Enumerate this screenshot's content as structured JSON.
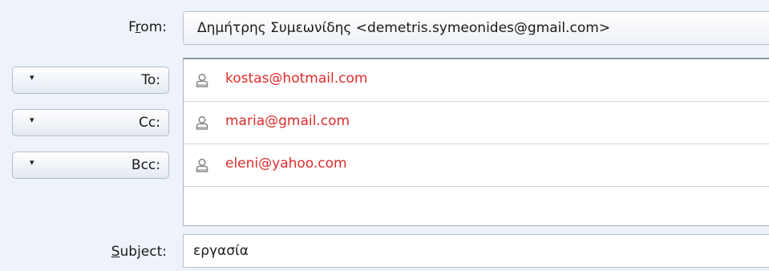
{
  "from": {
    "label_prefix": "F",
    "label_access": "r",
    "label_suffix": "om:",
    "value": "Δημήτρης Συμεωνίδης <demetris.symeonides@gmail.com>"
  },
  "recipients": [
    {
      "type": "To:",
      "address": "kostas@hotmail.com"
    },
    {
      "type": "Cc:",
      "address": "maria@gmail.com"
    },
    {
      "type": "Bcc:",
      "address": "eleni@yahoo.com"
    }
  ],
  "subject": {
    "label_access": "S",
    "label_suffix": "ubject:",
    "value": "εργασία"
  },
  "colors": {
    "address_text": "#e02b2b",
    "background": "#eef3fa"
  },
  "icons": {
    "caret": "caret-down-icon",
    "contact": "person-icon"
  }
}
